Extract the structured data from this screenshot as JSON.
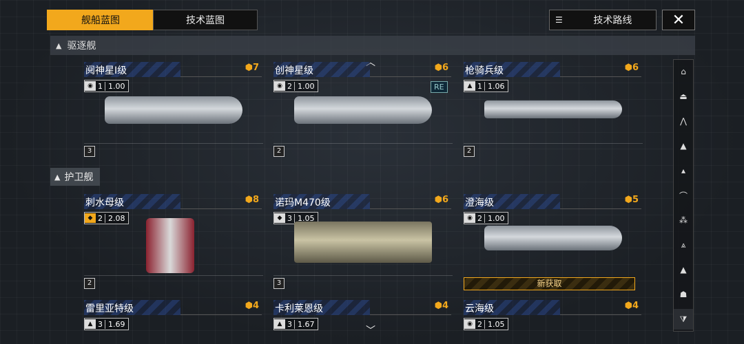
{
  "tabs": {
    "active": "舰船蓝图",
    "inactive": "技术蓝图"
  },
  "roadmap_label": "技术路线",
  "section": {
    "name": "驱逐舰"
  },
  "subsection": {
    "name": "护卫舰"
  },
  "acquire_label": "新获取",
  "cards": [
    {
      "title": "阋神星I级",
      "cost": "7",
      "level": "1",
      "value": "1.00",
      "tier": "3"
    },
    {
      "title": "创神星级",
      "cost": "6",
      "level": "2",
      "value": "1.00",
      "tier": "2",
      "badge": "RE"
    },
    {
      "title": "枪骑兵级",
      "cost": "6",
      "level": "1",
      "value": "1.06",
      "tier": "2"
    },
    {
      "title": "刺水母级",
      "cost": "8",
      "level": "2",
      "value": "2.08",
      "tier": "2"
    },
    {
      "title": "诺玛M470级",
      "cost": "6",
      "level": "3",
      "value": "1.05",
      "tier": "3"
    },
    {
      "title": "澄海级",
      "cost": "5",
      "level": "2",
      "value": "1.00",
      "tier": ""
    },
    {
      "title": "雷里亚特级",
      "cost": "4",
      "level": "3",
      "value": "1.69",
      "tier": ""
    },
    {
      "title": "卡利莱恩级",
      "cost": "4",
      "level": "3",
      "value": "1.67",
      "tier": ""
    },
    {
      "title": "云海级",
      "cost": "4",
      "level": "2",
      "value": "1.05",
      "tier": ""
    }
  ],
  "colors": {
    "accent": "#f2a81c",
    "background": "#1b1f24"
  }
}
